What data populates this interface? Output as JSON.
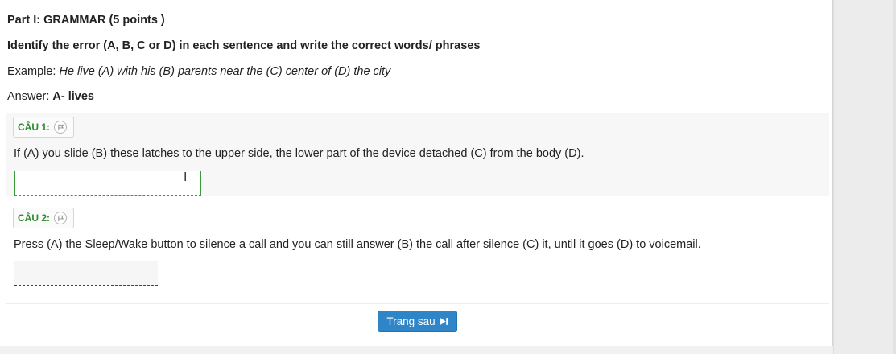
{
  "part_title": "Part I: GRAMMAR (5 points )",
  "instruction": "Identify the error (A, B, C or D) in each sentence and write the correct words/ phrases",
  "example": {
    "label": "Example:",
    "segments": [
      {
        "text": " He ",
        "u": false
      },
      {
        "text": "live ",
        "u": true
      },
      {
        "text": "(A) with ",
        "u": false
      },
      {
        "text": "his ",
        "u": true
      },
      {
        "text": "(B) parents near ",
        "u": false
      },
      {
        "text": "the ",
        "u": true
      },
      {
        "text": "(C) center ",
        "u": false
      },
      {
        "text": "of",
        "u": true
      },
      {
        "text": " (D) the city",
        "u": false
      }
    ]
  },
  "answer_example": {
    "label": "Answer:",
    "value": "A- lives"
  },
  "questions": [
    {
      "label": "CÂU 1:",
      "flag_icon": "flag-icon",
      "segments": [
        {
          "text": "If",
          "u": true
        },
        {
          "text": " (A) you ",
          "u": false
        },
        {
          "text": "slide",
          "u": true
        },
        {
          "text": " (B) these latches to the upper side, the lower part of the device ",
          "u": false
        },
        {
          "text": "detached",
          "u": true
        },
        {
          "text": " (C) from the ",
          "u": false
        },
        {
          "text": "body",
          "u": true
        },
        {
          "text": " (D).",
          "u": false
        }
      ],
      "answer_value": ""
    },
    {
      "label": "CÂU 2:",
      "flag_icon": "flag-icon",
      "segments": [
        {
          "text": "Press",
          "u": true
        },
        {
          "text": " (A) the Sleep/Wake button to silence a call and you can still ",
          "u": false
        },
        {
          "text": "answer",
          "u": true
        },
        {
          "text": " (B) the call after ",
          "u": false
        },
        {
          "text": "silence",
          "u": true
        },
        {
          "text": " (C) it, until it ",
          "u": false
        },
        {
          "text": "goes",
          "u": true
        },
        {
          "text": " (D) to voicemail.",
          "u": false
        }
      ],
      "answer_value": ""
    }
  ],
  "next_button": {
    "label": "Trang sau",
    "icon": "step-forward-icon"
  },
  "colors": {
    "question_label": "#2e8b2e",
    "button_bg": "#2e86c9",
    "active_input_border": "#3a9a3a"
  }
}
